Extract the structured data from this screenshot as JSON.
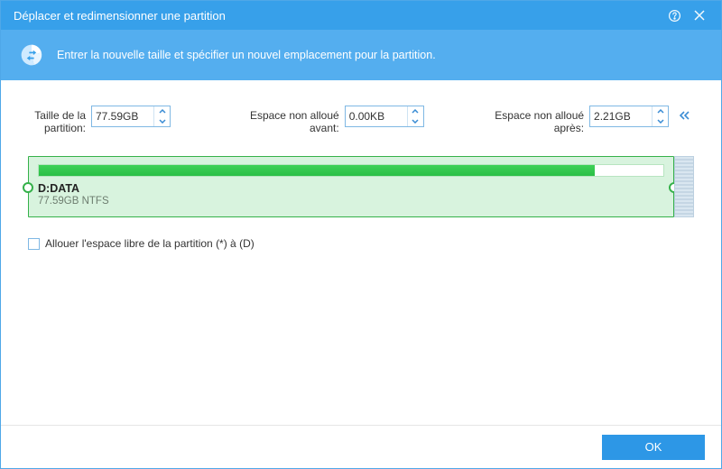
{
  "window": {
    "title": "Déplacer et redimensionner une partition"
  },
  "banner": {
    "text": "Entrer la nouvelle taille et spécifier un nouvel emplacement pour la partition."
  },
  "fields": {
    "size_label": "Taille de la\npartition:",
    "size_value": "77.59GB",
    "before_label": "Espace non alloué avant:",
    "before_value": "0.00KB",
    "after_label": "Espace non alloué après:",
    "after_value": "2.21GB"
  },
  "partition": {
    "name": "D:DATA",
    "subtitle": "77.59GB NTFS",
    "usage_percent": 89,
    "partition_width_percent": 97
  },
  "checkbox": {
    "label": "Allouer l'espace libre de la partition (*) à (D)",
    "checked": false
  },
  "footer": {
    "ok": "OK"
  },
  "colors": {
    "accent": "#37a0ea",
    "partition_green": "#35b14a"
  }
}
